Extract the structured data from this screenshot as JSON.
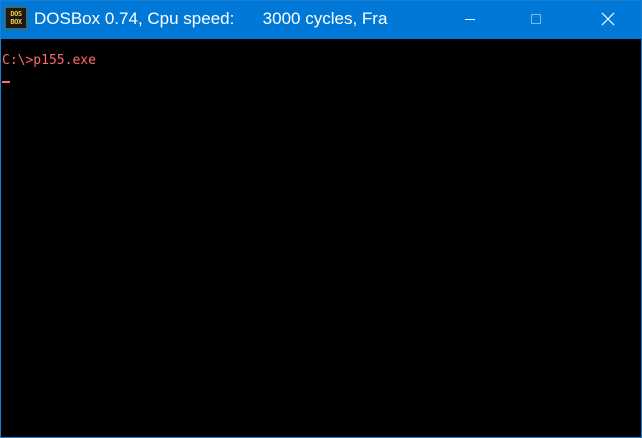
{
  "window": {
    "title": "DOSBox 0.74, Cpu speed:      3000 cycles, Fra",
    "icon": "dosbox-icon",
    "icon_text_top": "DOS",
    "icon_text_bottom": "BOX",
    "accent_color": "#0078d7"
  },
  "controls": {
    "minimize": "minimize-icon",
    "maximize": "maximize-icon",
    "close": "close-icon",
    "close_glyph": "✕"
  },
  "console": {
    "text_color": "#ff6b6b",
    "background": "#000000",
    "lines": [
      "C:\\>p155.exe"
    ]
  }
}
